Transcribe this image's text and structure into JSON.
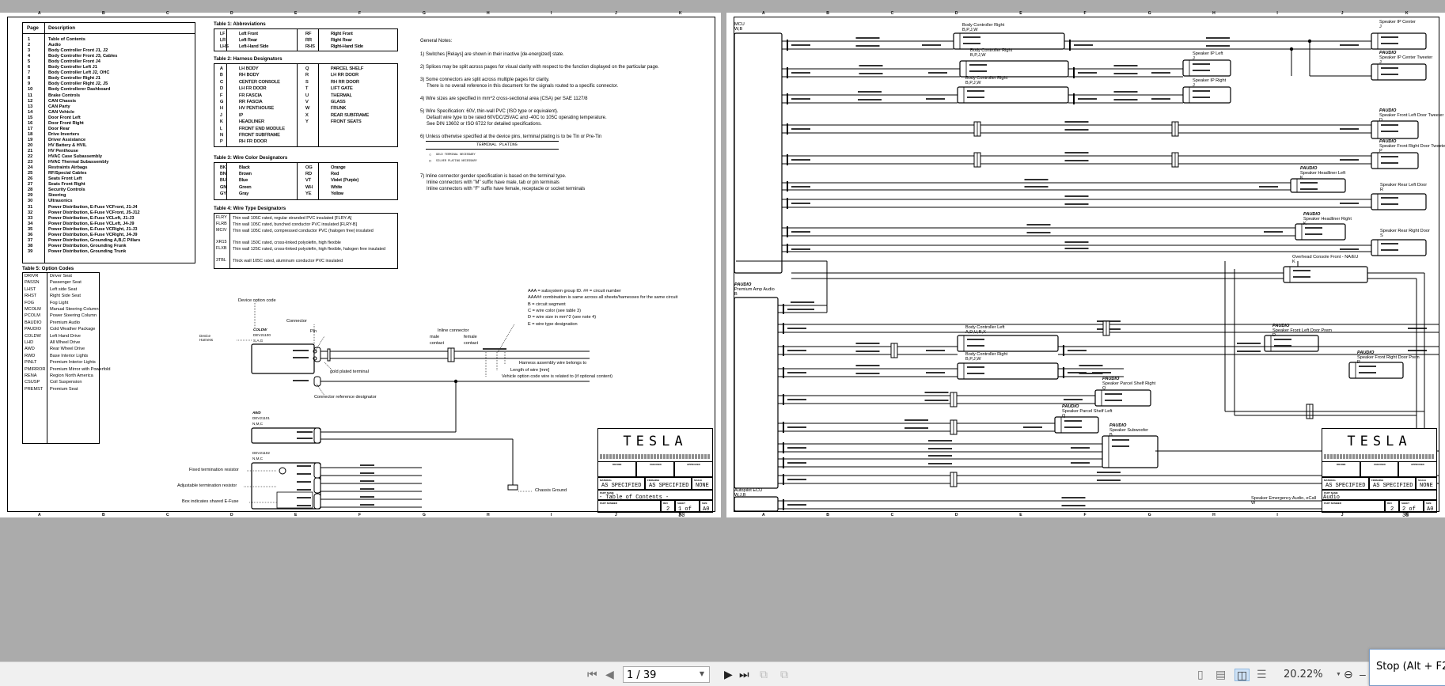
{
  "viewer": {
    "page_input": "1 / 39",
    "zoom_level": "20.22%",
    "stop_tooltip": "Stop (Alt + F2",
    "column_letters": [
      "A",
      "B",
      "C",
      "D",
      "E",
      "F",
      "G",
      "H",
      "I",
      "J",
      "K"
    ]
  },
  "page1": {
    "toc": {
      "header_page": "Page",
      "header_description": "Description",
      "rows": [
        [
          "1",
          "Table of Contents"
        ],
        [
          "2",
          "Audio"
        ],
        [
          "3",
          "Body Controller Front J1, J2"
        ],
        [
          "4",
          "Body Controller Front J3, Cables"
        ],
        [
          "5",
          "Body Controller Front J4"
        ],
        [
          "6",
          "Body Controller Left J1"
        ],
        [
          "7",
          "Body Controller Left J2, OHC"
        ],
        [
          "8",
          "Body Controller Right J1"
        ],
        [
          "9",
          "Body Controller Right J2, J5"
        ],
        [
          "10",
          "Body Controllerer Dashboard"
        ],
        [
          "11",
          "Brake Controls"
        ],
        [
          "12",
          "CAN Chassis"
        ],
        [
          "13",
          "CAN Party"
        ],
        [
          "14",
          "CAN Vehicle"
        ],
        [
          "15",
          "Door Front Left"
        ],
        [
          "16",
          "Door Front Right"
        ],
        [
          "17",
          "Door Rear"
        ],
        [
          "18",
          "Drive Inverters"
        ],
        [
          "19",
          "Driver Assistance"
        ],
        [
          "20",
          "HV Battery & HVIL"
        ],
        [
          "21",
          "HV Penthouse"
        ],
        [
          "22",
          "HVAC Case Subassembly"
        ],
        [
          "23",
          "HVAC Thermal Subassembly"
        ],
        [
          "24",
          "Restraints Airbags"
        ],
        [
          "25",
          "RF/Special Cables"
        ],
        [
          "26",
          "Seats Front Left"
        ],
        [
          "27",
          "Seats Front Right"
        ],
        [
          "28",
          "Security Controls"
        ],
        [
          "29",
          "Steering"
        ],
        [
          "30",
          "Ultrasonics"
        ],
        [
          "31",
          "Power Distribution, E-Fuse VCFront, J1-J4"
        ],
        [
          "32",
          "Power Distribution, E-Fuse VCFront, J5-J12"
        ],
        [
          "33",
          "Power Distribution, E-Fuse VCLeft, J1-J3"
        ],
        [
          "34",
          "Power Distribution, E-Fuse VCLeft, J4-J9"
        ],
        [
          "35",
          "Power Distribution, E-Fuse VCRight, J1-J3"
        ],
        [
          "36",
          "Power Distribution, E-Fuse VCRight, J4-J9"
        ],
        [
          "37",
          "Power Distribution, Grounding A,B,C Pillars"
        ],
        [
          "38",
          "Power Distribution, Grounding Frunk"
        ],
        [
          "39",
          "Power Distribution, Grounding Trunk"
        ]
      ]
    },
    "table1": {
      "title": "Table 1: Abbreviations",
      "rows": [
        [
          "LF",
          "Left Front",
          "RF",
          "Right Front"
        ],
        [
          "LR",
          "Left Rear",
          "RR",
          "Right Rear"
        ],
        [
          "LHS",
          "Left-Hand Side",
          "RHS",
          "Right-Hand Side"
        ]
      ]
    },
    "table2": {
      "title": "Table 2: Harness Designators",
      "rows": [
        [
          "A",
          "LH BODY",
          "Q",
          "PARCEL SHELF"
        ],
        [
          "B",
          "RH BODY",
          "R",
          "LH RR DOOR"
        ],
        [
          "C",
          "CENTER CONSOLE",
          "S",
          "RH RR DOOR"
        ],
        [
          "D",
          "LH FR DOOR",
          "T",
          "LIFT GATE"
        ],
        [
          "F",
          "FR FASCIA",
          "U",
          "THERMAL"
        ],
        [
          "G",
          "RR FASCIA",
          "V",
          "GLASS"
        ],
        [
          "H",
          "HV PENTHOUSE",
          "W",
          "FRUNK"
        ],
        [
          "J",
          "IP",
          "X",
          "REAR SUBFRAME"
        ],
        [
          "K",
          "HEADLINER",
          "Y",
          "FRONT SEATS"
        ],
        [
          "L",
          "FRONT END MODULE",
          "",
          ""
        ],
        [
          "N",
          "FRONT SUBFRAME",
          "",
          ""
        ],
        [
          "P",
          "RH FR DOOR",
          "",
          ""
        ]
      ]
    },
    "table3": {
      "title": "Table 3: Wire Color Designators",
      "rows": [
        [
          "BK",
          "Black",
          "OG",
          "Orange"
        ],
        [
          "BN",
          "Brown",
          "RD",
          "Red"
        ],
        [
          "BU",
          "Blue",
          "VT",
          "Violet (Purple)"
        ],
        [
          "GN",
          "Green",
          "WH",
          "White"
        ],
        [
          "GY",
          "Gray",
          "YE",
          "Yellow"
        ]
      ]
    },
    "table4": {
      "title": "Table 4: Wire Type Designators",
      "rows": [
        [
          "FLRY",
          "Thin wall 105C rated, regular stranded PVC insulated [FLRY-A]"
        ],
        [
          "FLRB",
          "Thin wall 105C rated, bunched conductor PVC insulated [FLRY-B]"
        ],
        [
          "MCIV",
          "Thin wall 105C rated, compressed conductor PVC (halogen free) insulated"
        ],
        [
          "XR15",
          "Thin wall 150C rated, cross-linked polyolefin, high flexible"
        ],
        [
          "FLXB",
          "Thin wall 125C rated, cross-linked polyolefin, high flexible, halogen free insulated"
        ],
        [
          "3TBL",
          "Thick wall 105C rated, aluminum conductor PVC insulated"
        ]
      ]
    },
    "table5": {
      "title": "Table 5: Option Codes",
      "rows": [
        [
          "DRIVR",
          "Driver Seat"
        ],
        [
          "PASSN",
          "Passenger Seat"
        ],
        [
          "LHST",
          "Left side Seat"
        ],
        [
          "RHST",
          "Right Side Seat"
        ],
        [
          "FOG",
          "Fog Light"
        ],
        [
          "MCOLM",
          "Manual Steering Column"
        ],
        [
          "PCOLM",
          "Power Steering Column"
        ],
        [
          "BAUDIO",
          "Premium Audio"
        ],
        [
          "PAUDIO",
          "Cold Weather Package"
        ],
        [
          "COLDW",
          "Left Hand Drive"
        ],
        [
          "LHD",
          "All Wheel Drive"
        ],
        [
          "AWD",
          "Rear Wheel Drive"
        ],
        [
          "RWD",
          "Base Interior Lights"
        ],
        [
          "PINLT",
          "Premium Interior Lights"
        ],
        [
          "PMIRROR",
          "Premium Mirror with Powerfold"
        ],
        [
          "RENA",
          "Region North America"
        ],
        [
          "CSUSP",
          "Coil Suspension"
        ],
        [
          "PREMST",
          "Premium Seat"
        ]
      ]
    },
    "notes": {
      "title": "General Notes:",
      "lines": [
        "1) Switches [Relays] are shown in their inactive [de-energized] state.",
        "2) Splices may be split across pages for visual clarity with respect to the function displayed on the particular page.",
        "3) Some connectors are split across multiple pages for clarity.",
        "There is no overall reference in this document for the signals routed to a specific connector.",
        "4) Wire sizes are specified in mm^2 cross-sectional area (CSA) per SAE 1127/8",
        "5) Wire Specification: 60V, thin-wall PVC (ISO type or equivalent).",
        "Default wire type to be rated 60VDC/25VAC and -40C to 105C operating temperature.",
        "See DIN 13602 or ISO 6722 for detailed specifications.",
        "6) Unless otherwise specified at the device pins, terminal plating is to be Tin or Pre-Tin",
        "7) Inline connector gender specification is based on the terminal type.",
        "Inline connectors with \"M\" suffix have male, tab or pin terminals",
        "Inline connectors with \"F\" suffix have female, receptacle or socket terminals"
      ],
      "plating_title": "TERMINAL PLATING",
      "plating_gold": "GOLD TERMINAL NECESSARY",
      "plating_silver": "SILVER PLATING NECESSARY"
    },
    "legend": {
      "device_option_code": "Device option code",
      "connector": "Connector",
      "pin": "Pin",
      "device": "Device",
      "harness": "Harness",
      "dev1_option": "COLDW",
      "dev1_name": "DEV21100",
      "dev1_harness": "S,A,G",
      "gold_plated_terminal": "gold plated terminal",
      "connector_ref": "Connector reference designator",
      "inline_connector": "Inline connector",
      "male_contact": "male",
      "female_contact": "female",
      "contact": "contact",
      "anno": [
        "AAA = subsystem group ID. ## = circuit number",
        "AAA## combination is same across all sheets/harnesses for the same circuit",
        "B = circuit segment",
        "C = wire color (see table 3)",
        "D = wire size in mm^2 (see note 4)",
        "E = wire type designation"
      ],
      "harness_assembly": "Harness assembly wire belongs to",
      "length_of_wire": "Length of wire [mm]",
      "vehicle_option": "Vehicle option code wire is related to (if optional content)",
      "dev2_option": "AWD",
      "dev2_name": "DEV21101",
      "dev2_harness": "N,M,C",
      "dev3_name": "DEV21102",
      "dev3_harness": "N,M,C",
      "fixed_term": "Fixed termination resistor",
      "adjustable_term": "Adjustable termination resistor",
      "shared_efuse": "Box indicates shared E-Fuse",
      "chassis_ground": "Chassis Ground"
    },
    "title_block": {
      "logo": "TESLA",
      "drawn": "DRAWN",
      "checked": "CHECKED",
      "approved": "APPROVED",
      "material_label": "MATERIAL",
      "material": "AS SPECIFIED",
      "finishing_label": "FINISHING",
      "finishing": "AS SPECIFIED",
      "scale_label": "SCALE",
      "scale": "NONE",
      "part_name_label": "PART NAME",
      "part_name": "- Table of Contents -",
      "part_number_label": "PART NUMBER",
      "rev_label": "REV",
      "rev": "2",
      "sheet_label": "SHEET",
      "sheet": "1 of 30",
      "size_label": "SIZE",
      "size": "A0"
    }
  },
  "page2": {
    "devices": [
      {
        "option": "",
        "name": "MCU",
        "harness": "W,B"
      },
      {
        "option": "",
        "name": "Body Controller Right",
        "harness": "B,P,J,W"
      },
      {
        "option": "",
        "name": "Body Controller Right",
        "harness": "B,P,J,W"
      },
      {
        "option": "",
        "name": "Body Controller Right",
        "harness": "B,P,J,W"
      },
      {
        "option": "",
        "name": "Speaker IP Center",
        "harness": "J"
      },
      {
        "option": "PAUDIO",
        "name": "Speaker IP Center Tweeter",
        "harness": "J"
      },
      {
        "option": "",
        "name": "Speaker IP Left",
        "harness": "J"
      },
      {
        "option": "",
        "name": "Speaker IP Right",
        "harness": "J"
      },
      {
        "option": "PAUDIO",
        "name": "Speaker Front Left Door Tweeter",
        "harness": "D"
      },
      {
        "option": "PAUDIO",
        "name": "Speaker Front Right Door Tweeter",
        "harness": "P"
      },
      {
        "option": "PAUDIO",
        "name": "Speaker Headliner Left",
        "harness": "K"
      },
      {
        "option": "",
        "name": "Speaker Rear Left Door",
        "harness": "R"
      },
      {
        "option": "PAUDIO",
        "name": "Speaker Headliner Right",
        "harness": "K"
      },
      {
        "option": "",
        "name": "Speaker Rear Right Door",
        "harness": "S"
      },
      {
        "option": "",
        "name": "Overhead Console Front - NA/EU",
        "harness": "K"
      },
      {
        "option": "PAUDIO",
        "name": "Premium Amp Audio",
        "harness": "B"
      },
      {
        "option": "",
        "name": "Body Controller Left",
        "harness": "A,D,U,R,X"
      },
      {
        "option": "",
        "name": "Body Controller Right",
        "harness": "B,P,J,W"
      },
      {
        "option": "PAUDIO",
        "name": "Speaker Front Left Door Prem",
        "harness": "D"
      },
      {
        "option": "PAUDIO",
        "name": "Speaker Front Right Door Prem",
        "harness": "P"
      },
      {
        "option": "PAUDIO",
        "name": "Speaker Parcel Shelf Right",
        "harness": "Q"
      },
      {
        "option": "PAUDIO",
        "name": "Speaker Parcel Shelf Left",
        "harness": "Q"
      },
      {
        "option": "PAUDIO",
        "name": "Speaker Subwoofer",
        "harness": "B"
      },
      {
        "option": "",
        "name": "Autopilot ECU",
        "harness": "W,J,B"
      },
      {
        "option": "",
        "name": "Speaker Emergency Audio, eCall",
        "harness": "W"
      }
    ],
    "title_block": {
      "logo": "TESLA",
      "drawn": "DRAWN",
      "checked": "CHECKED",
      "approved": "APPROVED",
      "material_label": "MATERIAL",
      "material": "AS SPECIFIED",
      "finishing_label": "FINISHING",
      "finishing": "AS SPECIFIED",
      "scale_label": "SCALE",
      "scale": "NONE",
      "part_name_label": "PART NAME",
      "part_name": "Audio",
      "part_number_label": "PART NUMBER",
      "rev_label": "REV",
      "rev": "2",
      "sheet_label": "SHEET",
      "sheet": "2 of 30",
      "size_label": "SIZE",
      "size": "A0"
    }
  }
}
